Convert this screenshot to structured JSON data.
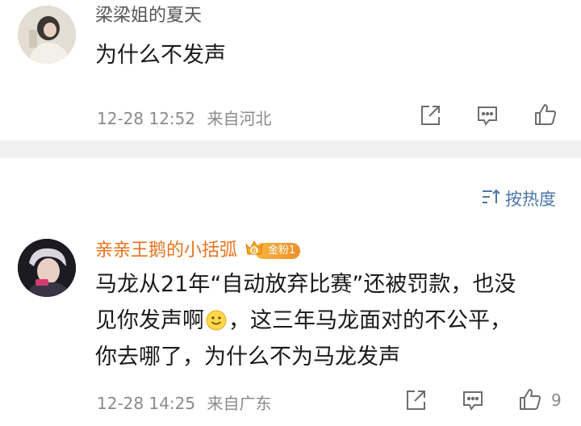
{
  "comments": [
    {
      "username": "梁梁姐的夏天",
      "text": "为什么不发声",
      "time": "12-28 12:52",
      "location": "来自河北",
      "like_count": ""
    },
    {
      "username": "亲亲王鹅的小括弧",
      "badge_level": "6",
      "badge_label": "金粉1",
      "text_line1": "马龙从21年“自动放弃比赛”还被罚款，也没",
      "text_line2a": "见你发声啊",
      "text_line2b": "，这三年马龙面对的不公平，",
      "text_line3": "你去哪了，为什么不为马龙发声",
      "time": "12-28 14:25",
      "location": "来自广东",
      "like_count": "9"
    }
  ],
  "sort": {
    "label": "按热度"
  },
  "colors": {
    "accent_link": "#4d77a6",
    "username_orange": "#e8721c",
    "username_gray": "#555555",
    "meta_gray": "#8a8a8a",
    "divider": "#f1f1f1"
  },
  "icons": [
    "share-icon",
    "comment-icon",
    "like-icon",
    "sort-icon",
    "smile-emoji-icon",
    "crown-badge-icon"
  ]
}
